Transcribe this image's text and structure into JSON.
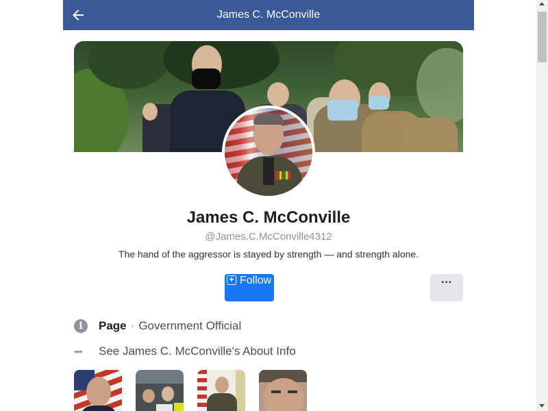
{
  "header": {
    "title": "James C. McConville",
    "back_icon": "arrow-left-icon"
  },
  "profile": {
    "name": "James C. McConville",
    "handle": "@James.C.McConville4312",
    "bio": "The hand of the aggressor is stayed by strength — and strength alone."
  },
  "actions": {
    "follow_label": "Follow",
    "follow_icon": "+",
    "more_label": "···"
  },
  "info": {
    "page_type": "Page",
    "separator": "·",
    "category": "Government Official",
    "about_link": "See James C. McConville's About Info"
  },
  "colors": {
    "header_bg": "#3b5998",
    "follow_bg": "#1877f2",
    "more_bg": "#e4e6eb"
  },
  "photos": [
    {
      "icon": "photo-thumbnail-1"
    },
    {
      "icon": "photo-thumbnail-2"
    },
    {
      "icon": "photo-thumbnail-3"
    },
    {
      "icon": "photo-thumbnail-4"
    }
  ]
}
